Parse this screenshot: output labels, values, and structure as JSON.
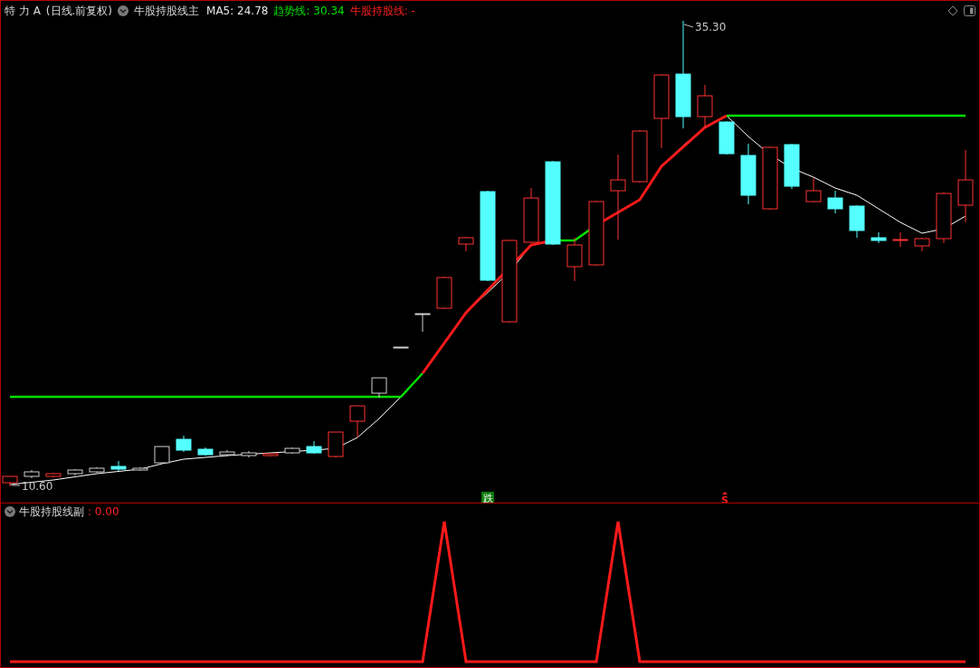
{
  "main_pane": {
    "stock_name": "特 力 A",
    "period": "(日线.前复权)",
    "indicator_name": "牛股持股线主",
    "ma5": "MA5: 24.78",
    "trend_line": "趋势线: 30.34",
    "hold_line": "牛股持股线: -",
    "high_label": "35.30",
    "low_label": "10.60",
    "signals": [
      {
        "kind": "badge",
        "text": "跌"
      },
      {
        "kind": "arrow",
        "text": "S"
      }
    ]
  },
  "sub_pane": {
    "indicator_name": "牛股持股线副",
    "value": ": 0.00"
  }
}
